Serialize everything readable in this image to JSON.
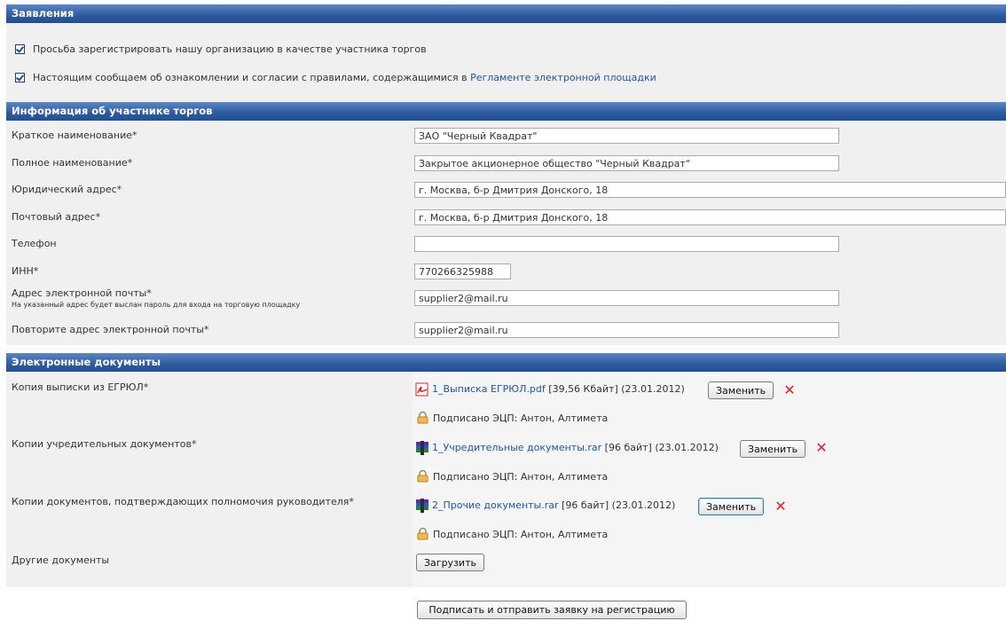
{
  "sections": {
    "statements": "Заявления",
    "participant": "Информация об участнике торгов",
    "documents": "Электронные документы"
  },
  "statements": {
    "item1": "Просьба зарегистрировать нашу организацию в качестве участника торгов",
    "item2_text": "Настоящим сообщаем об ознакомлении и согласии с правилами, содержащимися в ",
    "item2_link": "Регламенте электронной площадки"
  },
  "participant": {
    "short_name_label": "Краткое наименование*",
    "short_name_value": "ЗАО \"Черный Квадрат\"",
    "full_name_label": "Полное наименование*",
    "full_name_value": "Закрытое акционерное общество \"Черный Квадрат\"",
    "legal_address_label": "Юридический адрес*",
    "legal_address_value": "г. Москва, б-р Дмитрия Донского, 18",
    "postal_address_label": "Почтовый адрес*",
    "postal_address_value": "г. Москва, б-р Дмитрия Донского, 18",
    "phone_label": "Телефон",
    "phone_value": "",
    "inn_label": "ИНН*",
    "inn_value": "770266325988",
    "email_label": "Адрес электронной почты*",
    "email_hint": "На указанный адрес будет выслан пароль для входа на торговую площадку",
    "email_value": "supplier2@mail.ru",
    "email_repeat_label": "Повторите адрес электронной почты*",
    "email_repeat_value": "supplier2@mail.ru"
  },
  "documents": {
    "egrul_label": "Копия выписки из ЕГРЮЛ*",
    "egrul_file": "1_Выписка ЕГРЮЛ.pdf",
    "egrul_meta": " [39,56 Кбайт] (23.01.2012)",
    "founding_label": "Копии учредительных документов*",
    "founding_file": "1_Учредительные документы.rar",
    "founding_meta": " [96 байт] (23.01.2012)",
    "authority_label": "Копии документов, подтверждающих полномочия руководителя*",
    "authority_file": "2_Прочие документы.rar",
    "authority_meta": " [96 байт] (23.01.2012)",
    "signed_text": "Подписано ЭЦП: Антон, Алтимета",
    "replace_label": "Заменить",
    "other_label": "Другие документы",
    "upload_label": "Загрузить"
  },
  "submit_label": "Подписать и отправить заявку на регистрацию",
  "icons": {
    "delete": "red-x-icon",
    "pdf": "pdf-file-icon",
    "rar": "rar-archive-icon",
    "lock": "lock-icon"
  },
  "colors": {
    "header": "#2d5aa0",
    "link": "#2255a5",
    "delete": "#e21d2a"
  }
}
